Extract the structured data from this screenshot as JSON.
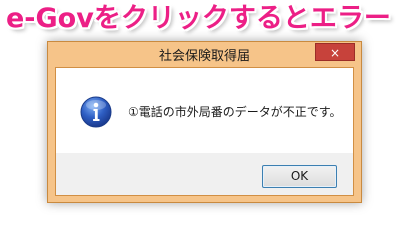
{
  "banner": {
    "text": "e-Govをクリックするとエラー"
  },
  "dialog": {
    "title": "社会保険取得届",
    "close_label": "×",
    "message": "①電話の市外局番のデータが不正です。",
    "icon": "info-icon",
    "ok_label": "OK"
  },
  "colors": {
    "banner_text": "#ec1f86",
    "frame": "#f6c489",
    "close_button": "#c7423b",
    "ok_border": "#3c7fb1"
  }
}
